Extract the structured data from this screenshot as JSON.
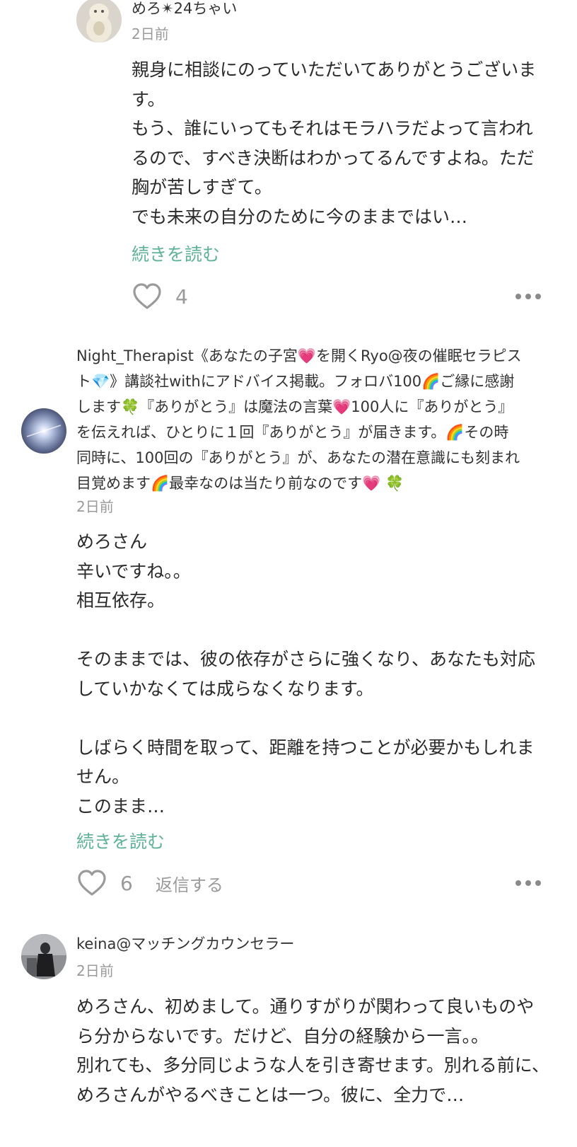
{
  "reply1": {
    "name": "めろ✴︎24ちゃい",
    "time": "2日前",
    "body": "親身に相談にのっていただいてありがとうございます。\nもう、誰にいってもそれはモラハラだよって言われるので、すべき決断はわかってるんですよね。ただ胸が苦しすぎて。\nでも未来の自分のために今のままではい…",
    "read_more": "続きを読む",
    "likes": "4"
  },
  "comment1": {
    "name_lines": [
      "Night_Therapist《あなたの子宮💗を開くRyo@夜の催眠セラピス",
      "ト💎》講談社withにアドバイス掲載。フォロバ100🌈ご縁に感謝",
      "します🍀『ありがとう』は魔法の言葉💗100人に『ありがとう』",
      "を伝えれば、ひとりに１回『ありがとう』が届きます。🌈その時",
      "同時に、100回の『ありがとう』が、あなたの潜在意識にも刻まれ",
      "目覚めます🌈最幸なのは当たり前なのです💗 🍀"
    ],
    "time": "2日前",
    "body": "めろさん\n辛いですね。。\n相互依存。\n\nそのままでは、彼の依存がさらに強くなり、あなたも対応していかなくては成らなくなります。\n\nしばらく時間を取って、距離を持つことが必要かもしれません。\nこのまま…",
    "read_more": "続きを読む",
    "likes": "6",
    "reply_label": "返信する"
  },
  "comment2": {
    "name": "keina@マッチングカウンセラー",
    "time": "2日前",
    "body": "めろさん、初めまして。通りすがりが関わって良いものやら分からないです。だけど、自分の経験から一言。。\n別れても、多分同じような人を引き寄せます。別れる前に、めろさんがやるべきことは一つ。彼に、全力で…"
  },
  "colors": {
    "accent_link": "#5fb39a",
    "meta_gray": "#9a9a9a",
    "text": "#2a2a2a"
  },
  "icons": {
    "like": "heart-outline-icon",
    "more": "more-dots-icon"
  }
}
